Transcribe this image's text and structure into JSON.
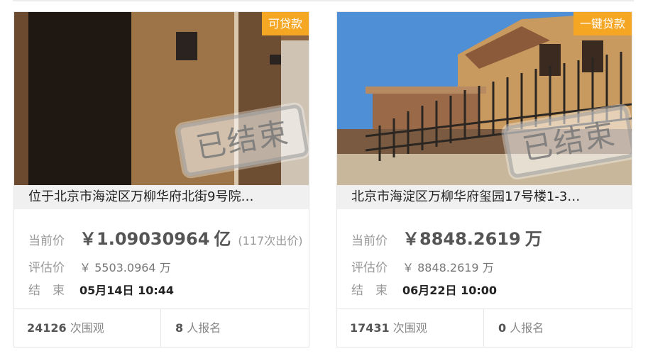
{
  "cards": [
    {
      "badge": "可贷款",
      "stamp": "已结束",
      "title": "位于北京市海淀区万柳华府北街9号院…",
      "current_label": "当前价",
      "current_price": "￥1.09030964",
      "current_unit": "亿",
      "bid_count": "(117次出价)",
      "estimate_label": "评估价",
      "estimate_price": "￥ 5503.0964 万",
      "end_label": "结　束",
      "end_time": "05月14日 10:44",
      "views_count": "24126",
      "views_label": "次围观",
      "signup_count": "8",
      "signup_label": "人报名"
    },
    {
      "badge": "一键贷款",
      "stamp": "已结束",
      "title": "北京市海淀区万柳华府玺园17号楼1-3…",
      "current_label": "当前价",
      "current_price": "￥8848.2619",
      "current_unit": "万",
      "bid_count": "",
      "estimate_label": "评估价",
      "estimate_price": "￥ 8848.2619 万",
      "end_label": "结　束",
      "end_time": "06月22日 10:00",
      "views_count": "17431",
      "views_label": "次围观",
      "signup_count": "0",
      "signup_label": "人报名"
    }
  ],
  "colors": {
    "badge": "#f5a623",
    "title_bg": "#f0f0f0",
    "border": "#e6e6e6"
  }
}
